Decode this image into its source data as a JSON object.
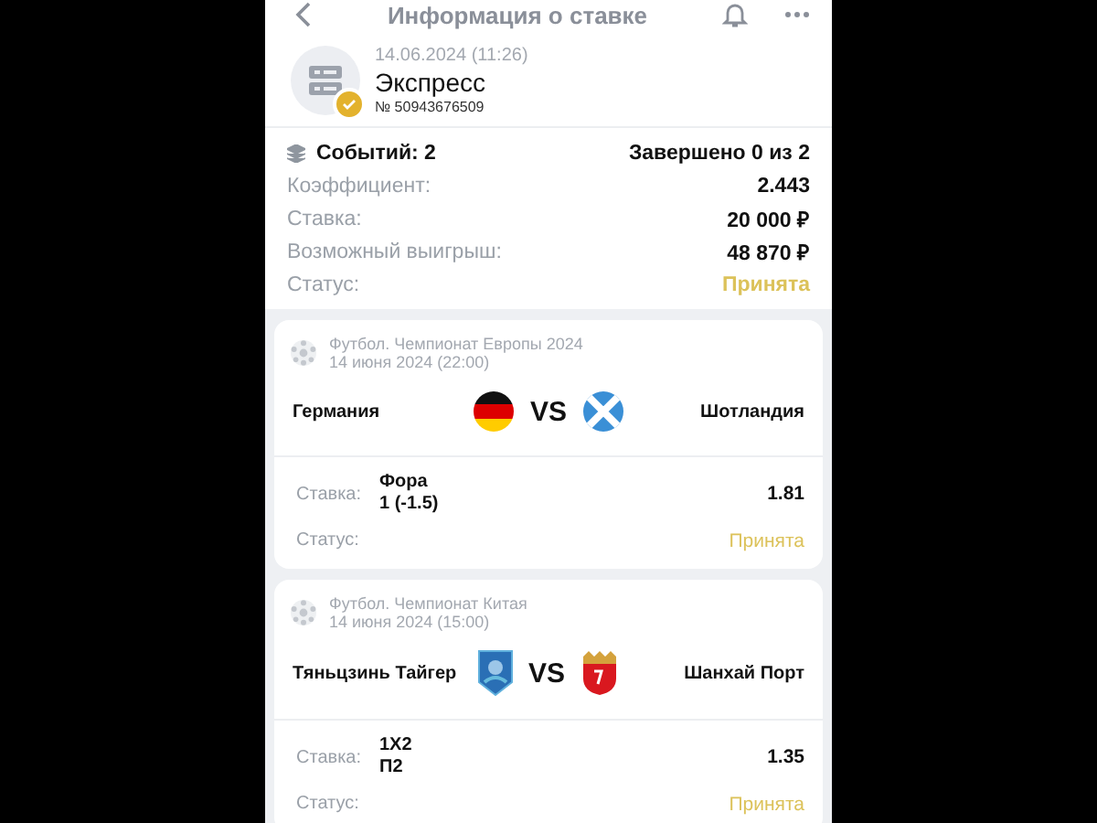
{
  "header": {
    "title": "Информация о ставке"
  },
  "summary": {
    "date": "14.06.2024 (11:26)",
    "type": "Экспресс",
    "number": "№ 50943676509",
    "events": "Событий: 2",
    "completed": "Завершено 0 из 2",
    "rows": [
      {
        "label": "Коэффициент:",
        "value": "2.443",
        "kind": "plain"
      },
      {
        "label": "Ставка:",
        "value": "20 000 ₽",
        "kind": "plain"
      },
      {
        "label": "Возможный выигрыш:",
        "value": "48 870 ₽",
        "kind": "plain"
      },
      {
        "label": "Статус:",
        "value": "Принята",
        "kind": "status"
      }
    ]
  },
  "events": [
    {
      "league": "Футбол. Чемпионат Европы 2024",
      "date": "14 июня 2024 (22:00)",
      "home": "Германия",
      "away": "Шотландия",
      "home_emblem": {
        "kind": "germany"
      },
      "away_emblem": {
        "kind": "scotland"
      },
      "vs": "VS",
      "bet_label": "Ставка:",
      "market": "Фора",
      "outcome": "1 (-1.5)",
      "odds": "1.81",
      "status_label": "Статус:",
      "status": "Принята"
    },
    {
      "league": "Футбол. Чемпионат Китая",
      "date": "14 июня 2024 (15:00)",
      "home": "Тяньцзинь Тайгер",
      "away": "Шанхай Порт",
      "home_emblem": {
        "kind": "tianjin"
      },
      "away_emblem": {
        "kind": "shanghai"
      },
      "vs": "VS",
      "bet_label": "Ставка:",
      "market": "1X2",
      "outcome": "П2",
      "odds": "1.35",
      "status_label": "Статус:",
      "status": "Принята"
    }
  ]
}
